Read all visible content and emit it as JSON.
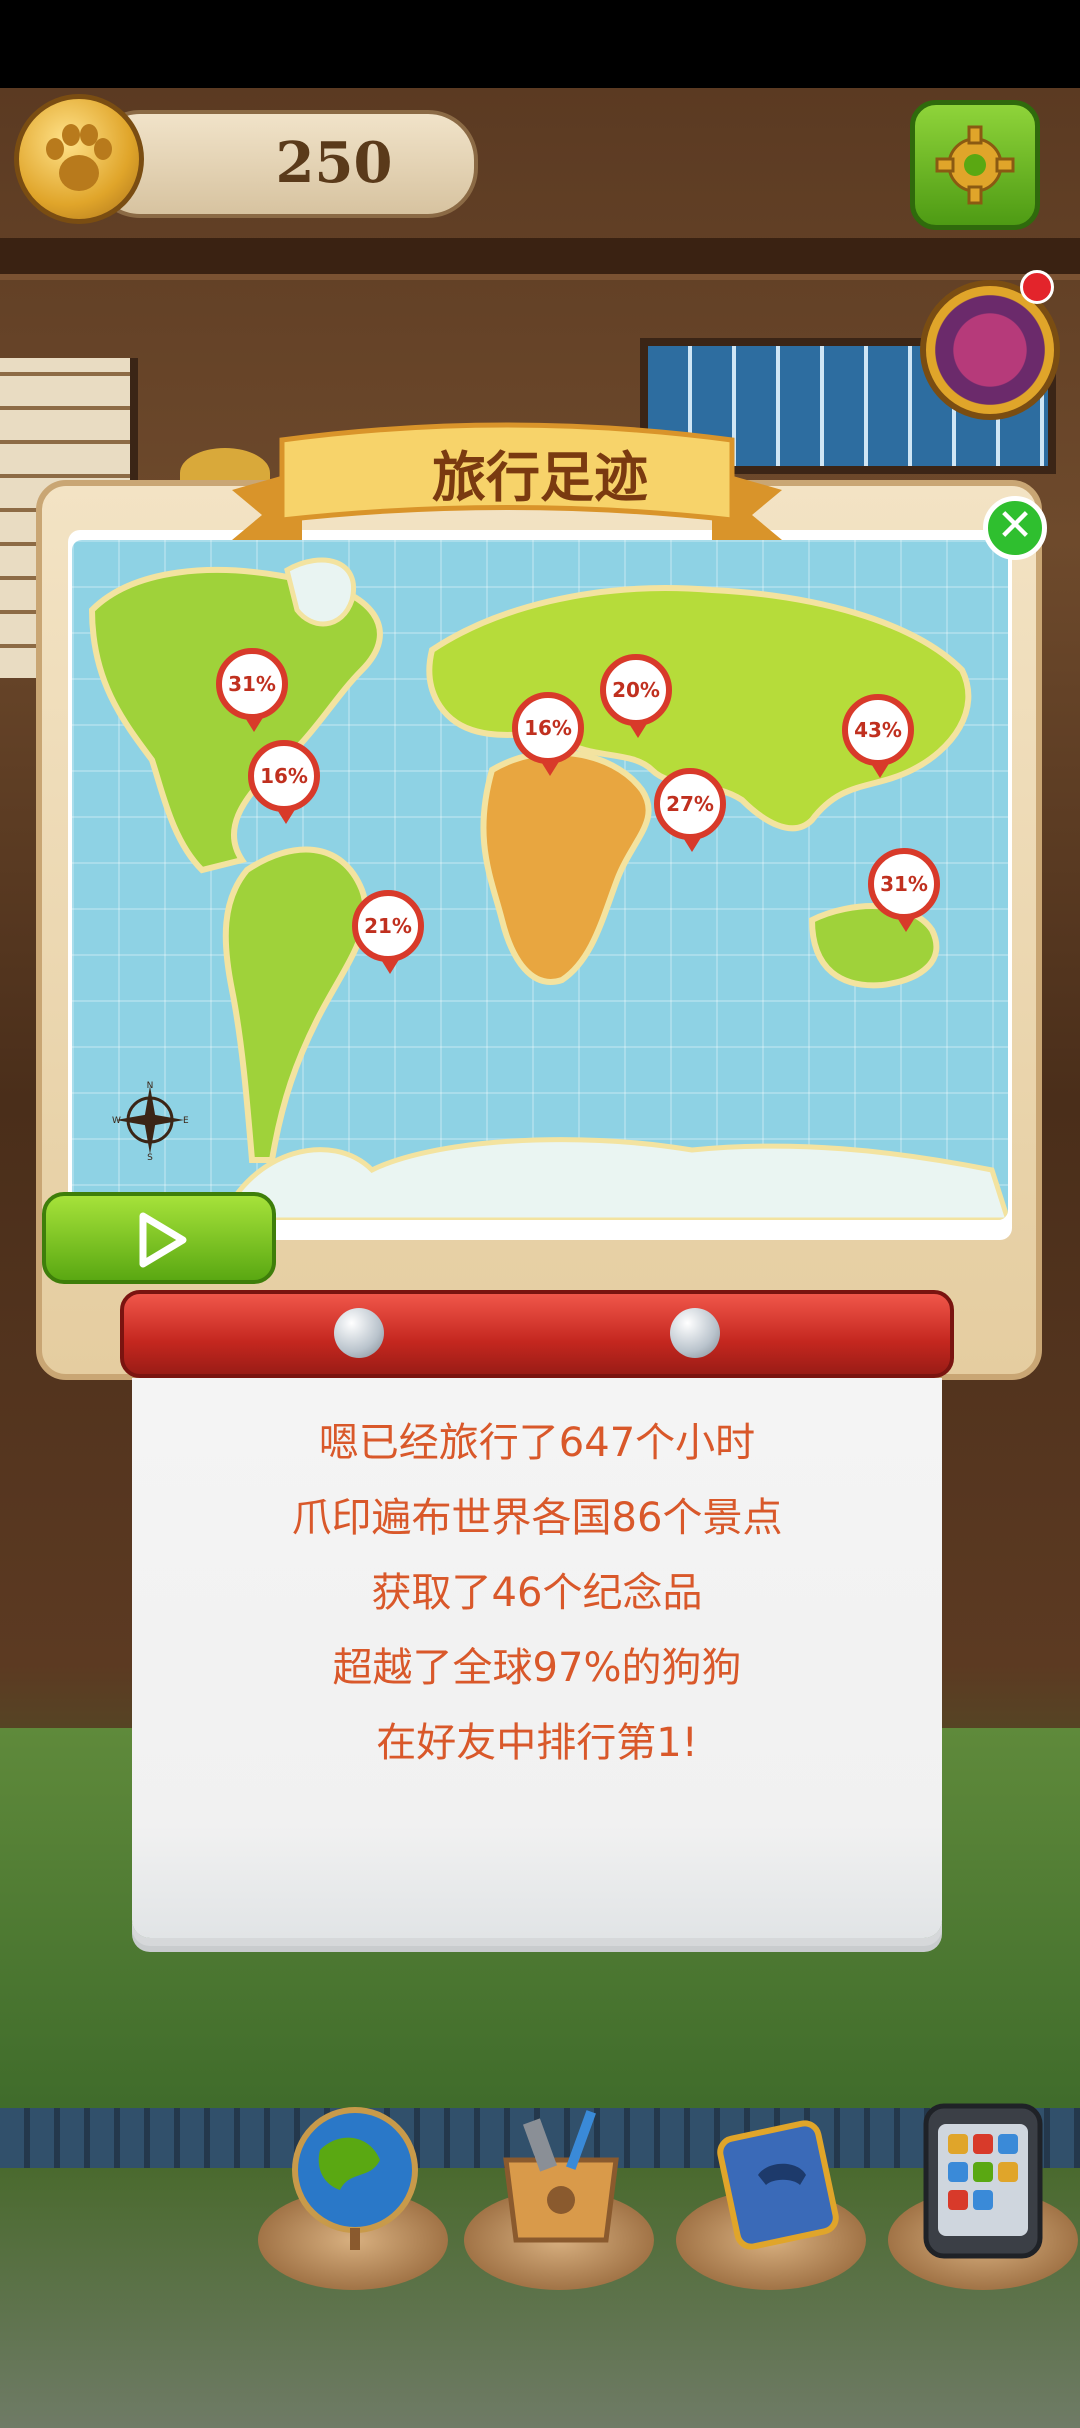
{
  "hud": {
    "coin_count": "250",
    "coin_icon": "paw-coin-icon",
    "settings_icon": "gear-icon",
    "spin_icon": "spin-wheel-icon"
  },
  "dialog": {
    "title": "旅行足迹",
    "close_icon": "close-icon",
    "close_label": "✕",
    "play_icon": "play-icon"
  },
  "map": {
    "pins": [
      {
        "label": "31%",
        "region": "North America"
      },
      {
        "label": "16%",
        "region": "North America"
      },
      {
        "label": "21%",
        "region": "South America"
      },
      {
        "label": "16%",
        "region": "Europe"
      },
      {
        "label": "20%",
        "region": "Europe"
      },
      {
        "label": "27%",
        "region": "Middle East"
      },
      {
        "label": "43%",
        "region": "East Asia"
      },
      {
        "label": "31%",
        "region": "Southeast Asia"
      }
    ],
    "compass_letters": {
      "n": "N",
      "s": "S",
      "w": "W",
      "e": "E"
    }
  },
  "stats": [
    "嗯已经旅行了647个小时",
    "爪印遍布世界各国86个景点",
    "获取了46个纪念品",
    "超越了全球97%的狗狗",
    "在好友中排行第1!"
  ],
  "bottom_nav": [
    {
      "name": "globe-icon"
    },
    {
      "name": "toolbox-icon"
    },
    {
      "name": "phone-book-icon"
    },
    {
      "name": "phone-apps-icon"
    }
  ],
  "colors": {
    "accent_green": "#5aa812",
    "pin_red": "#d83a2a",
    "stats_text": "#d9582a",
    "title_text": "#7a3a10",
    "ocean": "#8ed2e4"
  }
}
